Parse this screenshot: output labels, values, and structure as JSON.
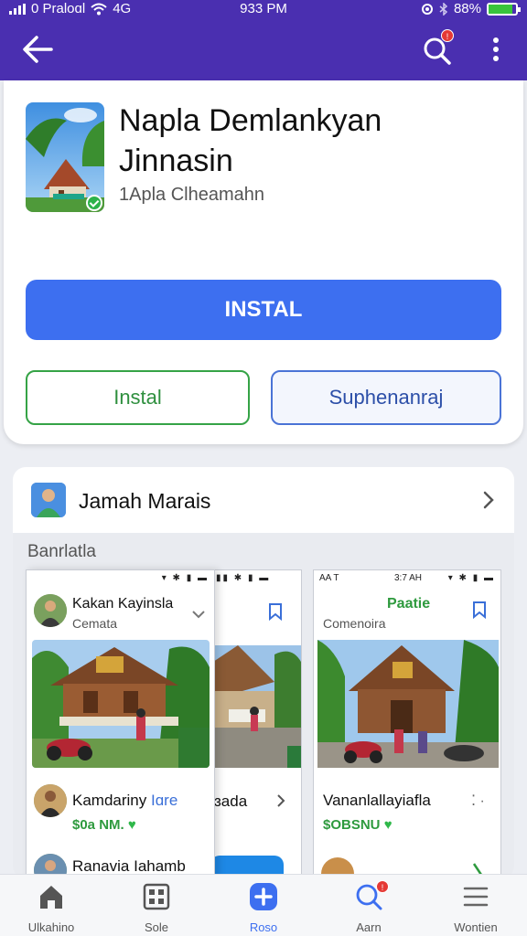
{
  "status_bar": {
    "carrier": "0 Praloɑl",
    "network": "4G",
    "time": "933 PM",
    "battery": "88%",
    "battery_level": 0.88
  },
  "app_bar": {
    "notification_badge": "!"
  },
  "app": {
    "title": "Napla Demlankyan Jinnasin",
    "developer": "1Apla Clheamahn",
    "primary_button": "INSTAL",
    "secondary_button_1": "Instal",
    "secondary_button_2": "Suphenanraj"
  },
  "developer_row": {
    "name": "Jamah Marais"
  },
  "section": {
    "label": "Banrlatla"
  },
  "screenshots": [
    {
      "status_time": "",
      "post_name": "Kakan Kayinsla",
      "post_sub": "Cemata",
      "listing_name": "Kamdariny",
      "listing_tag": "Iɑre",
      "price": "$0a NM.",
      "next_listing": "Ranavia Iahamb"
    },
    {
      "listing_name": "ɜada"
    },
    {
      "status_left": "AA T",
      "status_time": "3:7 AH",
      "post_action": "Paatie",
      "post_sub": "Comenoira",
      "listing_name": "Vananlallayiafla",
      "price": "$OBSNU"
    }
  ],
  "bottom_nav": [
    {
      "label": "Ulkahino",
      "icon": "home-icon"
    },
    {
      "label": "Sole",
      "icon": "grid-icon"
    },
    {
      "label": "Roso",
      "icon": "add-icon"
    },
    {
      "label": "Aarn",
      "icon": "search-icon"
    },
    {
      "label": "Wontien",
      "icon": "menu-icon"
    }
  ],
  "colors": {
    "header": "#4a2fb0",
    "primary": "#3d6ff0",
    "green": "#35a346"
  }
}
